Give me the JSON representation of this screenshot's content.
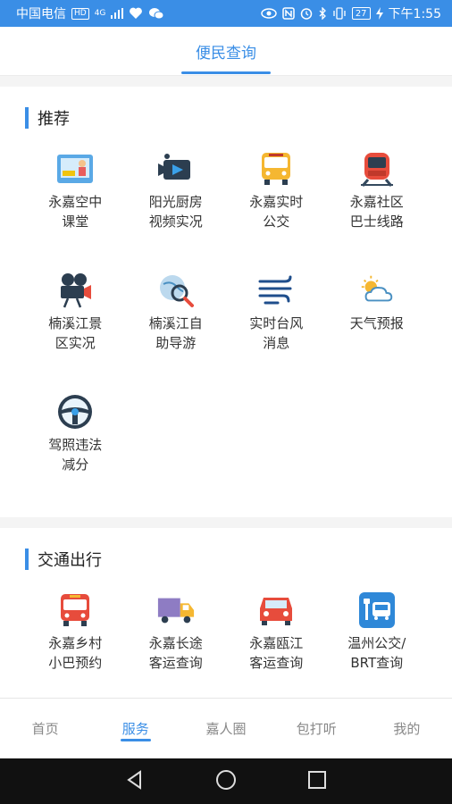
{
  "status": {
    "carrier": "中国电信",
    "hd": "HD",
    "net": "4G",
    "battery": "27",
    "time": "下午1:55"
  },
  "header": {
    "tab": "便民查询"
  },
  "sections": [
    {
      "title": "推荐",
      "items": [
        {
          "label": "永嘉空中\n课堂",
          "icon": "tablet-lesson-icon"
        },
        {
          "label": "阳光厨房\n视频实况",
          "icon": "video-camera-icon"
        },
        {
          "label": "永嘉实时\n公交",
          "icon": "bus-icon"
        },
        {
          "label": "永嘉社区\n巴士线路",
          "icon": "train-icon"
        },
        {
          "label": "楠溪江景\n区实况",
          "icon": "movie-camera-icon"
        },
        {
          "label": "楠溪江自\n助导游",
          "icon": "globe-search-icon"
        },
        {
          "label": "实时台风\n消息",
          "icon": "wind-icon"
        },
        {
          "label": "天气预报",
          "icon": "sun-cloud-icon"
        },
        {
          "label": "驾照违法\n减分",
          "icon": "steering-wheel-icon"
        }
      ]
    },
    {
      "title": "交通出行",
      "items": [
        {
          "label": "永嘉乡村\n小巴预约",
          "icon": "red-bus-icon"
        },
        {
          "label": "永嘉长途\n客运查询",
          "icon": "truck-icon"
        },
        {
          "label": "永嘉瓯江\n客运查询",
          "icon": "red-car-icon"
        },
        {
          "label": "温州公交/\nBRT查询",
          "icon": "bus-stop-icon"
        }
      ]
    }
  ],
  "bottom_nav": [
    {
      "label": "首页",
      "active": false
    },
    {
      "label": "服务",
      "active": true
    },
    {
      "label": "嘉人圈",
      "active": false
    },
    {
      "label": "包打听",
      "active": false
    },
    {
      "label": "我的",
      "active": false
    }
  ]
}
